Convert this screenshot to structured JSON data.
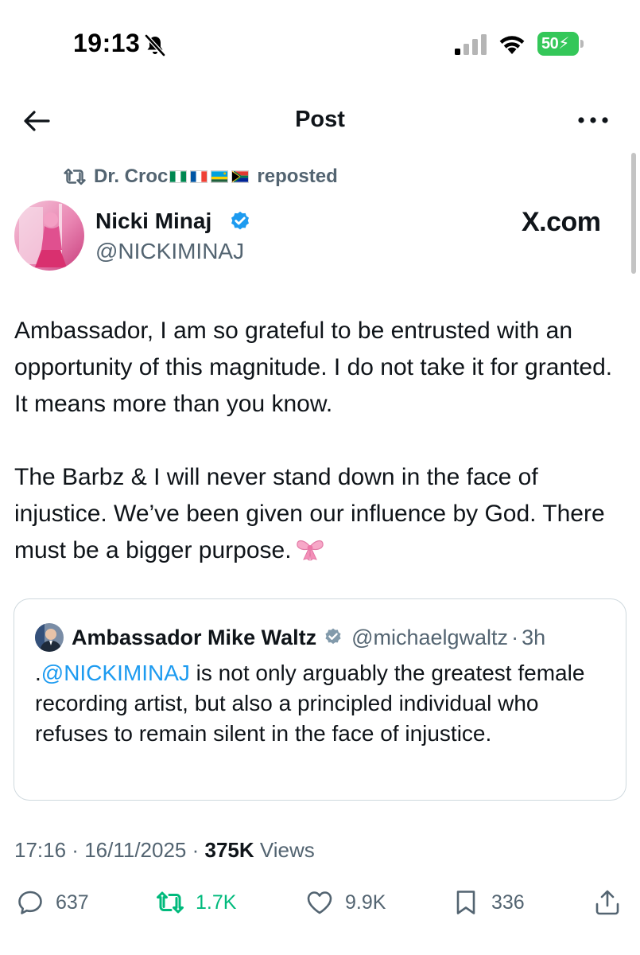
{
  "status_bar": {
    "time": "19:13",
    "battery_level": "50",
    "icons": [
      "silent-mode-icon",
      "cellular-signal-icon",
      "wifi-icon",
      "battery-icon"
    ]
  },
  "nav": {
    "title": "Post",
    "back_icon": "arrow-left-icon",
    "more_icon": "more-horizontal-icon"
  },
  "repost": {
    "reposter_name": "Dr. Croc",
    "flags": [
      "Nigeria",
      "France",
      "Rwanda",
      "South Africa"
    ],
    "label": "reposted"
  },
  "author": {
    "name": "Nicki Minaj",
    "handle": "@NICKIMINAJ",
    "verified": true,
    "watermark": "X.com"
  },
  "post": {
    "paragraph_1": "Ambassador, I am so grateful to be entrusted with an opportunity of this magnitude. I do not take it for granted. It means more than you know.",
    "paragraph_2": "The Barbz & I will never stand down in the face of injustice. We’ve been given our influence by God. There must be a bigger purpose.",
    "emoji": "ribbon-bow-emoji"
  },
  "quote": {
    "name": "Ambassador Mike Waltz",
    "handle": "@michaelgwaltz",
    "separator": "·",
    "time": "3h",
    "text_prefix": ".",
    "mention": "@NICKIMINAJ",
    "text_rest": " is not only arguably the greatest female recording artist, but also a principled individual who refuses to remain silent in the face of injustice."
  },
  "meta": {
    "time": "17:16",
    "separator": " · ",
    "date": "16/11/2025",
    "views_count": "375K",
    "views_label": " Views"
  },
  "actions": {
    "replies": "637",
    "reposts": "1.7K",
    "likes": "9.9K",
    "bookmarks": "336"
  },
  "colors": {
    "text_primary": "#0f1419",
    "text_secondary": "#536471",
    "accent_blue": "#1d9bf0",
    "repost_green": "#00ba7c",
    "battery_green": "#34c759"
  }
}
